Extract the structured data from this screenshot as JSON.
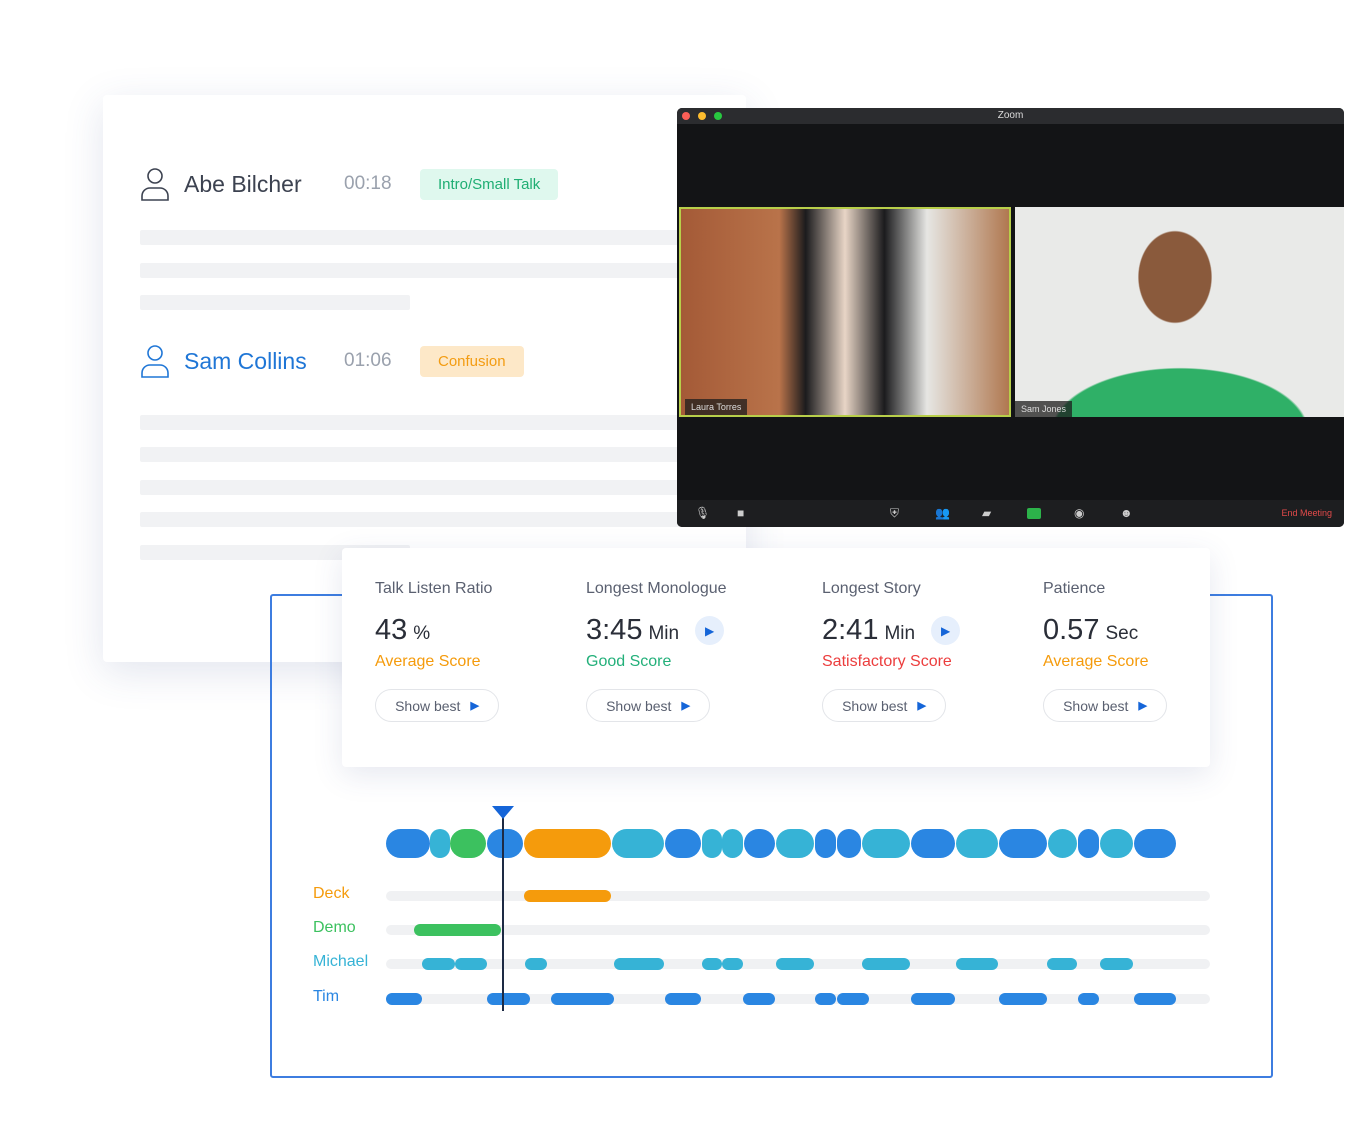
{
  "transcript": {
    "speakers": [
      {
        "name": "Abe Bilcher",
        "time": "00:18",
        "tag": "Intro/Small Talk",
        "name_color": "#3c4250",
        "tag_bg": "#dff8ee",
        "tag_color": "#1fae73"
      },
      {
        "name": "Sam Collins",
        "time": "01:06",
        "tag": "Confusion",
        "name_color": "#1f76d6",
        "tag_bg": "#fde8c8",
        "tag_color": "#f39c12"
      }
    ]
  },
  "zoom": {
    "title": "Zoom",
    "participants": [
      {
        "name": "Laura Torres"
      },
      {
        "name": "Sam Jones"
      }
    ],
    "end_meeting": "End Meeting",
    "icons": [
      "mic-muted-icon",
      "video-camera-icon",
      "security-shield-icon",
      "participants-icon",
      "chat-icon",
      "share-screen-icon",
      "record-icon",
      "reactions-icon"
    ]
  },
  "metrics": [
    {
      "title": "Talk Listen Ratio",
      "value": "43",
      "unit": "%",
      "score": "Average Score",
      "score_color": "#f59b0c",
      "button": "Show best",
      "has_play": false
    },
    {
      "title": "Longest Monologue",
      "value": "3:45",
      "unit": "Min",
      "score": "Good Score",
      "score_color": "#23b07a",
      "button": "Show best",
      "has_play": true
    },
    {
      "title": "Longest Story",
      "value": "2:41",
      "unit": "Min",
      "score": "Satisfactory Score",
      "score_color": "#ec3d3d",
      "button": "Show best",
      "has_play": true
    },
    {
      "title": "Patience",
      "value": "0.57",
      "unit": "Sec",
      "score": "Average Score",
      "score_color": "#f59b0c",
      "button": "Show best",
      "has_play": false
    }
  ],
  "timeline": {
    "rows": [
      {
        "label": "Deck",
        "color": "#f59b0c"
      },
      {
        "label": "Demo",
        "color": "#3cc15f"
      },
      {
        "label": "Michael",
        "color": "#36b3d6"
      },
      {
        "label": "Tim",
        "color": "#2a86e2"
      }
    ]
  }
}
